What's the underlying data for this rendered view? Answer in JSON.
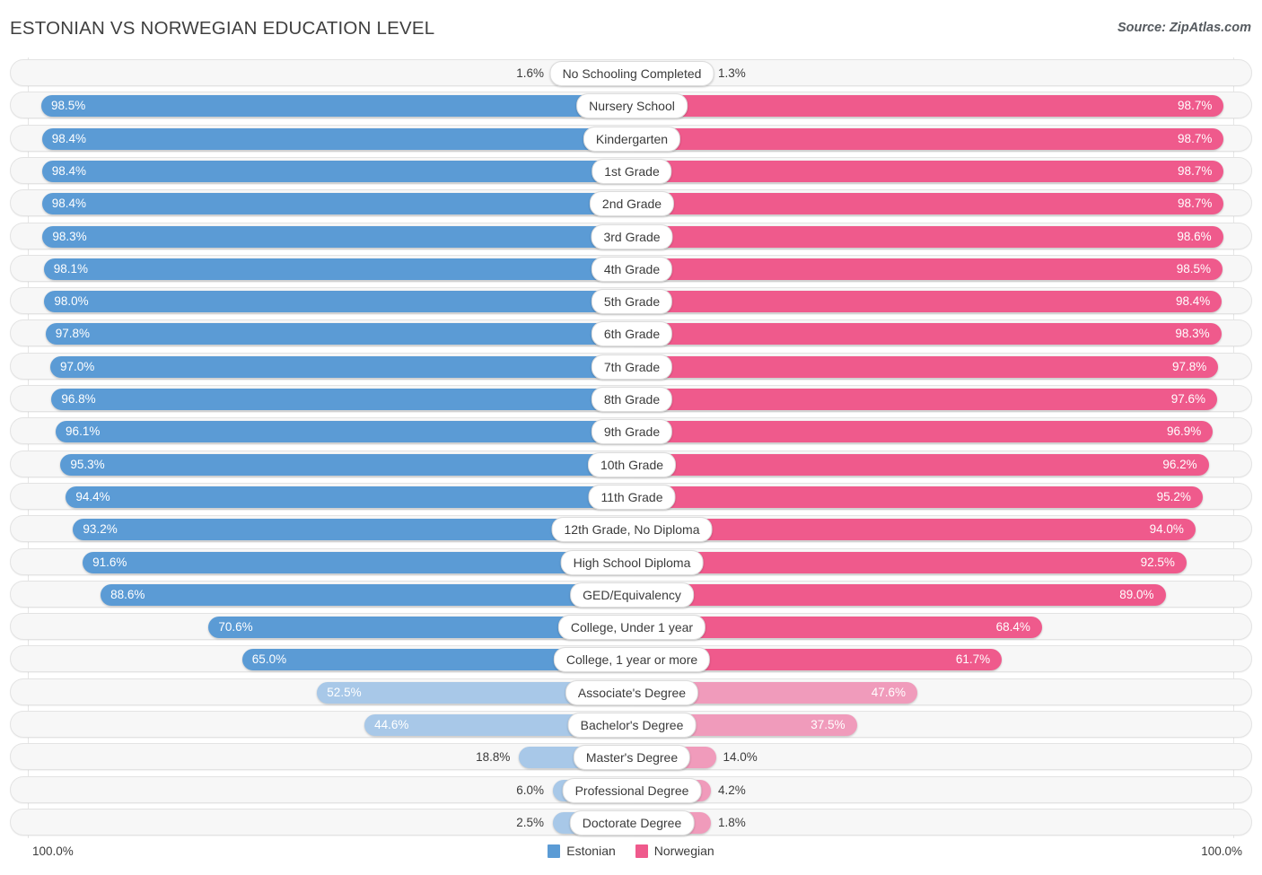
{
  "header": {
    "title": "ESTONIAN VS NORWEGIAN EDUCATION LEVEL",
    "source": "Source: ZipAtlas.com"
  },
  "legend": {
    "items": [
      {
        "label": "Estonian",
        "color": "#5b9bd5"
      },
      {
        "label": "Norwegian",
        "color": "#ef5a8c"
      }
    ]
  },
  "axis": {
    "left_max": "100.0%",
    "right_max": "100.0%"
  },
  "colors": {
    "estonian_strong": "#5b9bd5",
    "estonian_light": "#a8c8e8",
    "norwegian_strong": "#ef5a8c",
    "norwegian_light": "#f09bbb",
    "row_bg": "#f7f7f7",
    "row_border": "#e3e3e3"
  },
  "chart_data": {
    "type": "bar",
    "orientation": "diverging-horizontal",
    "title": "ESTONIAN VS NORWEGIAN EDUCATION LEVEL",
    "xlabel": "",
    "ylabel": "",
    "xlim": [
      0,
      100
    ],
    "grid": false,
    "legend_position": "bottom-center",
    "categories": [
      "No Schooling Completed",
      "Nursery School",
      "Kindergarten",
      "1st Grade",
      "2nd Grade",
      "3rd Grade",
      "4th Grade",
      "5th Grade",
      "6th Grade",
      "7th Grade",
      "8th Grade",
      "9th Grade",
      "10th Grade",
      "11th Grade",
      "12th Grade, No Diploma",
      "High School Diploma",
      "GED/Equivalency",
      "College, Under 1 year",
      "College, 1 year or more",
      "Associate's Degree",
      "Bachelor's Degree",
      "Master's Degree",
      "Professional Degree",
      "Doctorate Degree"
    ],
    "series": [
      {
        "name": "Estonian",
        "color": "#5b9bd5",
        "values": [
          1.6,
          98.5,
          98.4,
          98.4,
          98.4,
          98.3,
          98.1,
          98.0,
          97.8,
          97.0,
          96.8,
          96.1,
          95.3,
          94.4,
          93.2,
          91.6,
          88.6,
          70.6,
          65.0,
          52.5,
          44.6,
          18.8,
          6.0,
          2.5
        ],
        "labels": [
          "1.6%",
          "98.5%",
          "98.4%",
          "98.4%",
          "98.4%",
          "98.3%",
          "98.1%",
          "98.0%",
          "97.8%",
          "97.0%",
          "96.8%",
          "96.1%",
          "95.3%",
          "94.4%",
          "93.2%",
          "91.6%",
          "88.6%",
          "70.6%",
          "65.0%",
          "52.5%",
          "44.6%",
          "18.8%",
          "6.0%",
          "2.5%"
        ]
      },
      {
        "name": "Norwegian",
        "color": "#ef5a8c",
        "values": [
          1.3,
          98.7,
          98.7,
          98.7,
          98.7,
          98.6,
          98.5,
          98.4,
          98.3,
          97.8,
          97.6,
          96.9,
          96.2,
          95.2,
          94.0,
          92.5,
          89.0,
          68.4,
          61.7,
          47.6,
          37.5,
          14.0,
          4.2,
          1.8
        ],
        "labels": [
          "1.3%",
          "98.7%",
          "98.7%",
          "98.7%",
          "98.7%",
          "98.6%",
          "98.5%",
          "98.4%",
          "98.3%",
          "97.8%",
          "97.6%",
          "96.9%",
          "96.2%",
          "95.2%",
          "94.0%",
          "92.5%",
          "89.0%",
          "68.4%",
          "61.7%",
          "47.6%",
          "37.5%",
          "14.0%",
          "4.2%",
          "1.8%"
        ]
      }
    ]
  }
}
